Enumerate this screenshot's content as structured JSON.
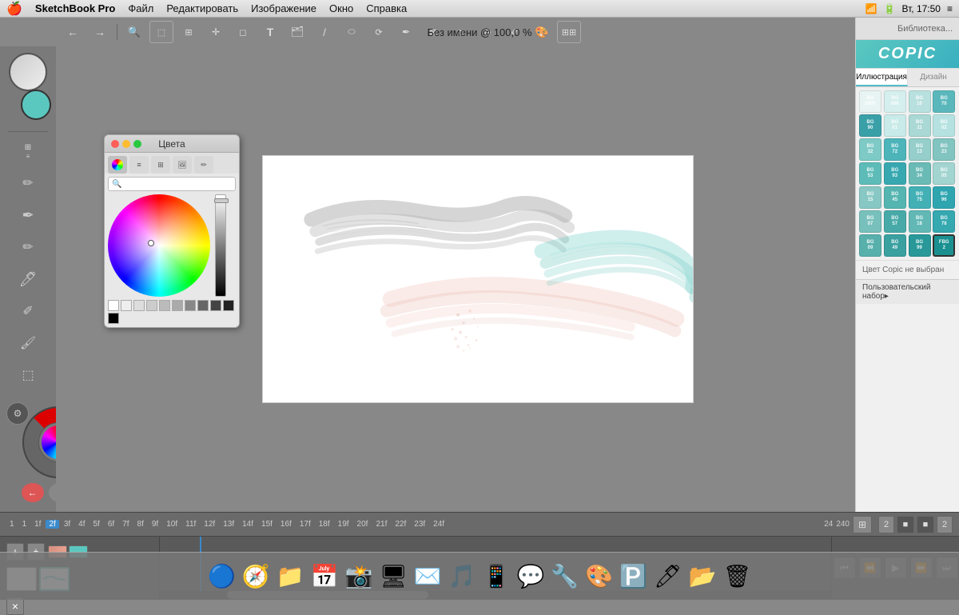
{
  "menubar": {
    "app_name": "SketchBook Pro",
    "menus": [
      "Файл",
      "Редактировать",
      "Изображение",
      "Окно",
      "Справка"
    ],
    "right_time": "Вт, 17:50",
    "window_title": "Без имени @ 100,0 %"
  },
  "toolbar": {
    "tools": [
      "←",
      "→",
      "🔍",
      "⬜",
      "⊞",
      "✛",
      "◻",
      "T",
      "🗂",
      "/",
      "⬭",
      "⟳",
      "✎",
      "⊠",
      "≋",
      "⊕",
      "✐",
      "🎨",
      "⊞"
    ]
  },
  "left_sidebar": {
    "tools": [
      "⊞",
      "≡",
      "✏",
      "✏",
      "✏",
      "✏",
      "✏",
      "✏",
      "✏",
      "✏",
      "✏",
      "✏",
      "✏"
    ]
  },
  "color_dialog": {
    "title": "Цвета",
    "tabs": [
      "●",
      "≡",
      "⊞",
      "🖼",
      "⬛"
    ],
    "search_placeholder": "",
    "search_value": ""
  },
  "copic_panel": {
    "header": "Библиотека...",
    "logo": "COPIC",
    "tabs": [
      "Иллюстрация",
      "Дизайн"
    ],
    "active_tab": 0,
    "swatches": [
      {
        "label": "BG\n0000",
        "color": "#e8f4f4"
      },
      {
        "label": "BG\n000",
        "color": "#d5eeee"
      },
      {
        "label": "BG\n10",
        "color": "#b8e0de"
      },
      {
        "label": "BG\n70",
        "color": "#5ab8bc"
      },
      {
        "label": "BG\n90",
        "color": "#3aa0a8"
      },
      {
        "label": "BG\n01",
        "color": "#c8eae8"
      },
      {
        "label": "BG\n11",
        "color": "#aad8d5"
      },
      {
        "label": "BG\n02",
        "color": "#b5e2e0"
      },
      {
        "label": "BG\n32",
        "color": "#7ecac6"
      },
      {
        "label": "BG\n72",
        "color": "#4db5ba"
      },
      {
        "label": "BG\n13",
        "color": "#95ceca"
      },
      {
        "label": "BG\n23",
        "color": "#82c4c0"
      },
      {
        "label": "BG\n53",
        "color": "#5ebcb8"
      },
      {
        "label": "BG\n93",
        "color": "#38a8b0"
      },
      {
        "label": "BG\n34",
        "color": "#6abab5"
      },
      {
        "label": "BG\n05",
        "color": "#a2d4d0"
      },
      {
        "label": "BG\n15",
        "color": "#88c8c4"
      },
      {
        "label": "BG\n45",
        "color": "#55b5b0"
      },
      {
        "label": "BG\n75",
        "color": "#42b0b5"
      },
      {
        "label": "BG\n96",
        "color": "#2fa5b0"
      },
      {
        "label": "BG\n07",
        "color": "#78c0bc"
      },
      {
        "label": "BG\n57",
        "color": "#48aaa8"
      },
      {
        "label": "BG\n18",
        "color": "#62b8b5"
      },
      {
        "label": "BG\n78",
        "color": "#35a8b0"
      },
      {
        "label": "BG\n09",
        "color": "#58b0ac"
      },
      {
        "label": "BG\n49",
        "color": "#3aa0a0"
      },
      {
        "label": "BG\n99",
        "color": "#289898"
      },
      {
        "label": "FBG\n2",
        "color": "#1a9090",
        "active": true
      }
    ],
    "status_text": "Цвет Copic не выбран",
    "custom_text": "Пользовательский набор▸"
  },
  "timeline": {
    "frames": [
      "1",
      "1",
      "1f",
      "2f",
      "3f",
      "4f",
      "5f",
      "6f",
      "7f",
      "8f",
      "9f",
      "10f",
      "11f",
      "12f",
      "13f",
      "14f",
      "15f",
      "16f",
      "17f",
      "18f",
      "19f",
      "20f",
      "21f",
      "22f",
      "23f",
      "24f"
    ],
    "active_frame": "2f",
    "end_frame": "24",
    "total_frames": "240",
    "fps_value": "2",
    "playback_btns": [
      "⏮",
      "⏪",
      "▶",
      "⏩",
      "⏭"
    ],
    "add_btn": "+",
    "minus_btn": "×"
  }
}
